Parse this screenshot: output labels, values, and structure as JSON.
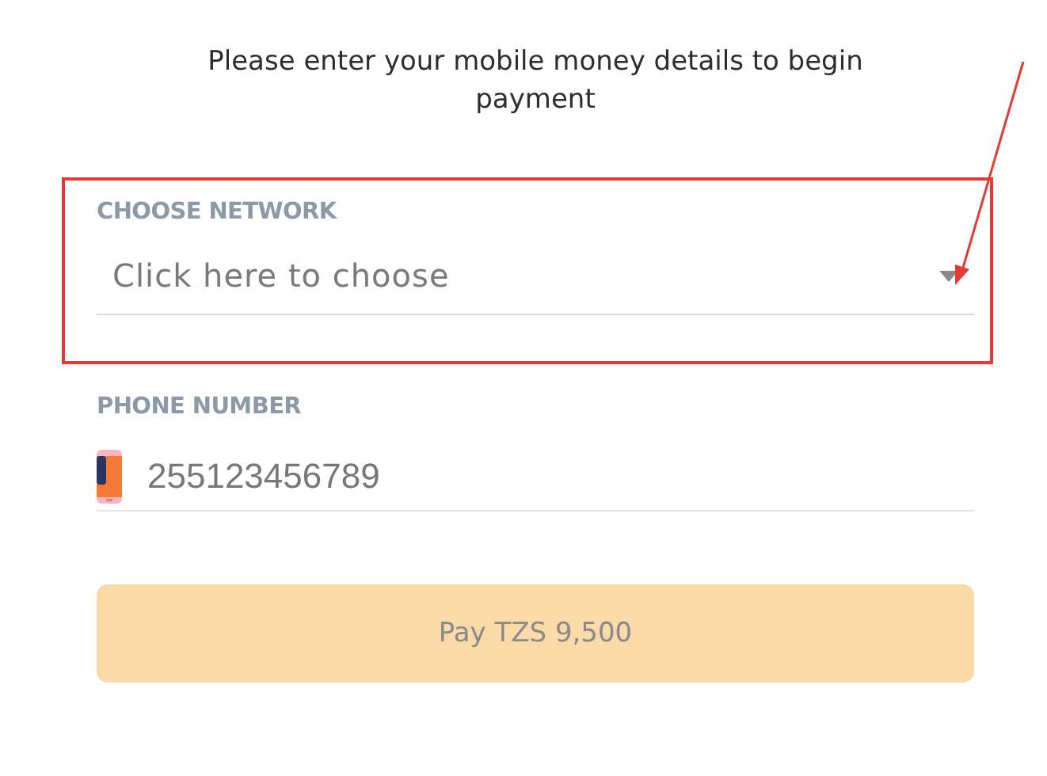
{
  "intro": "Please enter your mobile money details to begin payment",
  "network": {
    "label": "CHOOSE NETWORK",
    "placeholder": "Click here to choose"
  },
  "phone": {
    "label": "PHONE NUMBER",
    "placeholder": "255123456789"
  },
  "pay_button": {
    "label": "Pay TZS 9,500",
    "disabled": true
  }
}
